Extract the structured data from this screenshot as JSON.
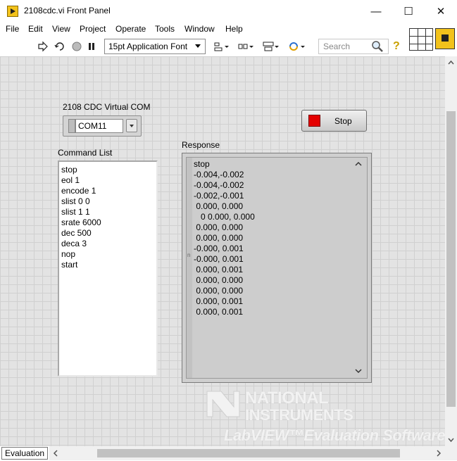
{
  "window": {
    "title": "2108cdc.vi Front Panel",
    "minimize_glyph": "—",
    "maximize_glyph": "☐",
    "close_glyph": "✕"
  },
  "menu": [
    "File",
    "Edit",
    "View",
    "Project",
    "Operate",
    "Tools",
    "Window",
    "Help"
  ],
  "toolbar": {
    "font_label": "15pt Application Font",
    "search_placeholder": "Search",
    "help_glyph": "?",
    "icons": [
      "run-arrow-icon",
      "run-continuously-icon",
      "abort-icon",
      "pause-icon",
      "align-objects-icon",
      "distribute-objects-icon",
      "resize-objects-icon",
      "reorder-icon",
      "search-icon",
      "help-icon"
    ]
  },
  "panel": {
    "com_control": {
      "label": "2108 CDC Virtual COM",
      "value": "COM11"
    },
    "stop_button": {
      "label": "Stop",
      "led_color": "#e40000"
    },
    "command_list": {
      "label": "Command List",
      "lines": [
        "stop",
        "eol 1",
        "encode 1",
        "slist 0 0",
        "slist 1 1",
        "srate 6000",
        "dec 500",
        "deca 3",
        "nop",
        "start"
      ]
    },
    "response": {
      "label": "Response",
      "lines": [
        "stop",
        "-0.004,-0.002",
        "-0.004,-0.002",
        "-0.002,-0.001",
        " 0.000, 0.000",
        "   0 0.000, 0.000",
        " 0.000, 0.000",
        " 0.000, 0.000",
        "-0.000, 0.001",
        "-0.000, 0.001",
        " 0.000, 0.001",
        " 0.000, 0.000",
        " 0.000, 0.000",
        " 0.000, 0.001",
        " 0.000, 0.001"
      ],
      "gutter_mark": "n"
    },
    "watermark": {
      "line1": "NATIONAL",
      "line2": "INSTRUMENTS",
      "line3": "LabVIEW™Evaluation Software"
    }
  },
  "status": {
    "mode_badge": "Evaluation"
  },
  "colors": {
    "panel_bg": "#e3e3e3",
    "grid": "#d0d0d0",
    "accent_yellow": "#f2c21b"
  }
}
